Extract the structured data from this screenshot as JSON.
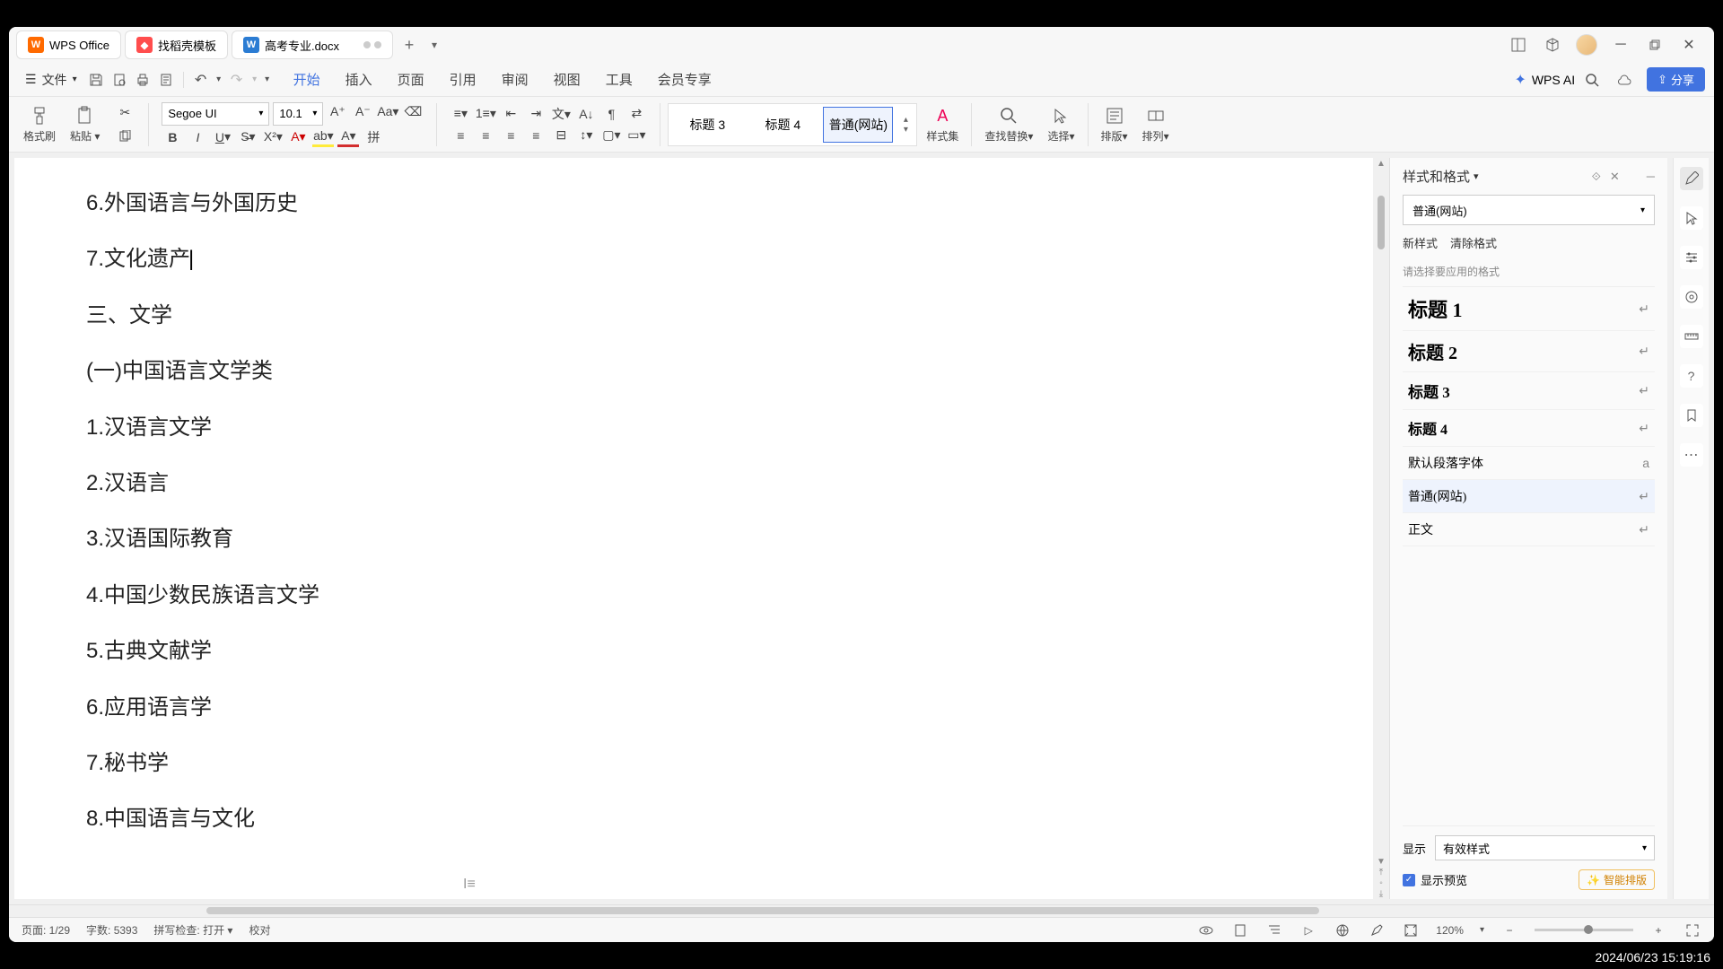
{
  "tabs": {
    "wps_home": "WPS Office",
    "template": "找稻壳模板",
    "document": "高考专业.docx"
  },
  "quick": {
    "file_menu": "文件"
  },
  "menu": {
    "items": [
      "开始",
      "插入",
      "页面",
      "引用",
      "审阅",
      "视图",
      "工具",
      "会员专享"
    ],
    "active_index": 0
  },
  "wps_ai": "WPS AI",
  "share_button": "分享",
  "ribbon": {
    "format_painter": "格式刷",
    "paste": "粘贴",
    "font_name": "Segoe UI",
    "font_size": "10.1",
    "style_gallery": [
      "标题 3",
      "标题 4",
      "普通(网站)"
    ],
    "style_gallery_selected": 2,
    "style_set": "样式集",
    "find_replace": "查找替换",
    "select": "选择",
    "layout": "排版",
    "arrange": "排列"
  },
  "document": {
    "lines": [
      "6.外国语言与外国历史",
      "7.文化遗产",
      "三、文学",
      "(一)中国语言文学类",
      "1.汉语言文学",
      "2.汉语言",
      "3.汉语国际教育",
      "4.中国少数民族语言文学",
      "5.古典文献学",
      "6.应用语言学",
      "7.秘书学",
      "8.中国语言与文化"
    ],
    "cursor_line_index": 1
  },
  "styles_panel": {
    "title": "样式和格式",
    "current_style": "普通(网站)",
    "new_style": "新样式",
    "clear_format": "清除格式",
    "hint": "请选择要应用的格式",
    "list": [
      {
        "label": "标题 1",
        "cls": "h1",
        "mark": "↵"
      },
      {
        "label": "标题 2",
        "cls": "h2",
        "mark": "↵"
      },
      {
        "label": "标题 3",
        "cls": "h3",
        "mark": "↵"
      },
      {
        "label": "标题 4",
        "cls": "h4",
        "mark": "↵"
      },
      {
        "label": "默认段落字体",
        "cls": "def",
        "mark": "a"
      },
      {
        "label": "普通(网站)",
        "cls": "norm",
        "mark": "↵",
        "selected": true
      },
      {
        "label": "正文",
        "cls": "body",
        "mark": "↵"
      }
    ],
    "display_label": "显示",
    "display_value": "有效样式",
    "show_preview": "显示预览",
    "smart_layout": "智能排版"
  },
  "status": {
    "page": "页面: 1/29",
    "words": "字数: 5393",
    "spell": "拼写检查: 打开",
    "proof": "校对",
    "zoom": "120%"
  },
  "timestamp": "2024/06/23 15:19:16"
}
